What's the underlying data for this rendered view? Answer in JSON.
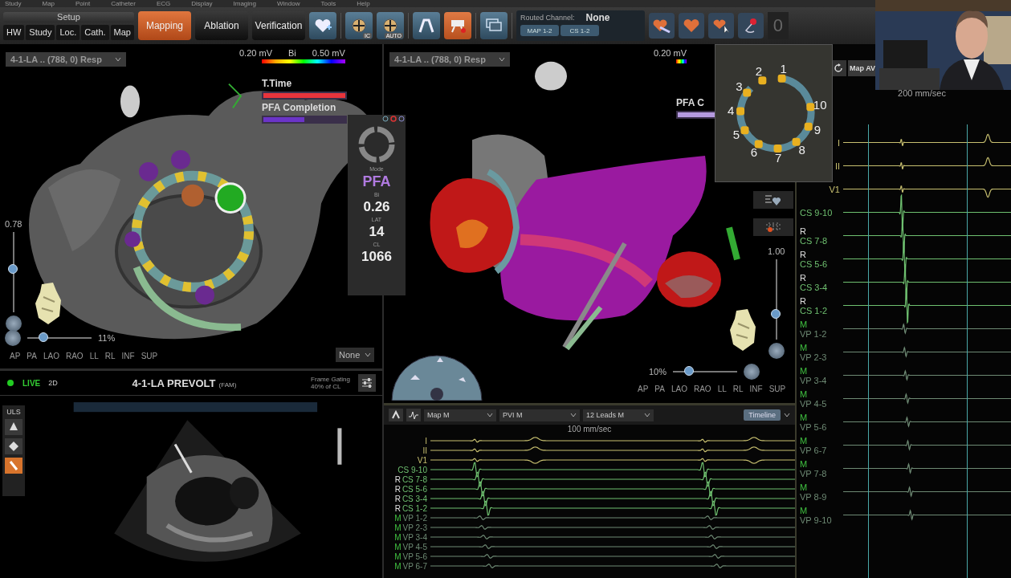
{
  "menu": [
    "Study",
    "Map",
    "Point",
    "Catheter",
    "ECG",
    "Display",
    "Imaging",
    "Window",
    "Tools",
    "Help"
  ],
  "toolbar": {
    "setup": {
      "label": "Setup",
      "tabs": [
        {
          "label": "HW",
          "selected": false
        },
        {
          "label": "Study",
          "selected": false
        },
        {
          "label": "Loc.",
          "selected": false
        },
        {
          "label": "Cath.",
          "selected": false
        },
        {
          "label": "Map",
          "selected": false
        }
      ]
    },
    "workflow": [
      {
        "label": "Mapping",
        "selected": true
      },
      {
        "label": "Ablation",
        "selected": false
      },
      {
        "label": "Verification",
        "selected": false
      }
    ],
    "tools": [
      {
        "kind": "heart-plus",
        "selected": false
      },
      {
        "kind": "target",
        "badge": "IC",
        "selected": false
      },
      {
        "kind": "target",
        "badge": "AUTO",
        "selected": false
      },
      {
        "kind": "arch",
        "selected": false
      },
      {
        "kind": "projector",
        "selected": true
      },
      {
        "kind": "windows",
        "selected": false
      }
    ],
    "routed_channel": {
      "label": "Routed Channel:",
      "value": "None",
      "channels": [
        "MAP 1-2",
        "CS 1-2"
      ]
    },
    "map_tools": [
      {
        "kind": "heart-arrow"
      },
      {
        "kind": "heart"
      },
      {
        "kind": "heart-pointer"
      },
      {
        "kind": "pin"
      }
    ],
    "counter": "0"
  },
  "left_map": {
    "view": "4-1-LA .. (788, 0) Resp",
    "scale": {
      "min": "0.20 mV",
      "name": "Bi",
      "max": "0.50 mV"
    },
    "legend": [
      {
        "label": "T.Time",
        "color": "#e8343c",
        "level": 1
      },
      {
        "label": "PFA Completion",
        "color": "#6b34c8",
        "level": 0.5
      }
    ],
    "opacity": {
      "reading": "0.78",
      "level": 0.55
    },
    "zoom": {
      "reading": "11%",
      "level": 0.2
    },
    "views": [
      "AP",
      "PA",
      "LAO",
      "RAO",
      "LL",
      "RL",
      "INF",
      "SUP"
    ],
    "overlay": "None"
  },
  "readout": {
    "mode_label": "Mode",
    "mode": "PFA",
    "fields": [
      {
        "label": "Bi",
        "value": "0.26"
      },
      {
        "label": "LAT",
        "value": "14"
      },
      {
        "label": "CL",
        "value": "1066"
      }
    ]
  },
  "right_map": {
    "view": "4-1-LA .. (788, 0) Resp",
    "scale_min": "0.20 mV",
    "legend": [
      {
        "label": "PFA C",
        "color": "#b59ae0",
        "level": 1
      }
    ],
    "opacity": {
      "reading": "1.00",
      "level": 0.3
    },
    "zoom": {
      "reading": "10%",
      "level": 0.2
    },
    "views": [
      "AP",
      "PA",
      "LAO",
      "RAO",
      "LL",
      "RL",
      "INF",
      "SUP"
    ]
  },
  "catheter_view": {
    "electrodes": [
      "1",
      "2",
      "3",
      "4",
      "5",
      "6",
      "7",
      "8",
      "9",
      "10"
    ]
  },
  "ultrasound": {
    "live": "LIVE",
    "mode": "2D",
    "title": "4-1-LA PREVOLT",
    "suffix": "(FAM)",
    "gating": {
      "label": "Frame Gating",
      "value": "40% of CL"
    },
    "tools_label": "ULS",
    "tools": [
      {
        "kind": "probe",
        "selected": false
      },
      {
        "kind": "plane",
        "selected": false
      },
      {
        "kind": "catheter",
        "selected": true
      }
    ]
  },
  "timeline_ecg": {
    "dropdowns": [
      "Map M",
      "PVI M",
      "12 Leads M"
    ],
    "timeline": "Timeline",
    "speed": "100 mm/sec",
    "channels": [
      {
        "name": "I",
        "kind": "surface"
      },
      {
        "name": "II",
        "kind": "surface"
      },
      {
        "name": "V1",
        "kind": "surface"
      },
      {
        "name": "CS 9-10",
        "kind": "cs"
      },
      {
        "name": "CS 7-8",
        "tag": "R",
        "kind": "cs"
      },
      {
        "name": "CS 5-6",
        "tag": "R",
        "kind": "cs"
      },
      {
        "name": "CS 3-4",
        "tag": "R",
        "kind": "cs"
      },
      {
        "name": "CS 1-2",
        "tag": "R",
        "kind": "cs"
      },
      {
        "name": "VP 1-2",
        "tag": "M",
        "kind": "vp"
      },
      {
        "name": "VP 2-3",
        "tag": "M",
        "kind": "vp"
      },
      {
        "name": "VP 3-4",
        "tag": "M",
        "kind": "vp"
      },
      {
        "name": "VP 4-5",
        "tag": "M",
        "kind": "vp"
      },
      {
        "name": "VP 5-6",
        "tag": "M",
        "kind": "vp"
      },
      {
        "name": "VP 6-7",
        "tag": "M",
        "kind": "vp"
      }
    ]
  },
  "ecg": {
    "button": "Map AV",
    "speed": "200 mm/sec",
    "channels": [
      {
        "name": "I",
        "kind": "surface"
      },
      {
        "name": "II",
        "kind": "surface"
      },
      {
        "name": "V1",
        "kind": "surface"
      },
      {
        "name": "CS 9-10",
        "kind": "cs"
      },
      {
        "name": "CS 7-8",
        "tag": "R",
        "kind": "cs"
      },
      {
        "name": "CS 5-6",
        "tag": "R",
        "kind": "cs"
      },
      {
        "name": "CS 3-4",
        "tag": "R",
        "kind": "cs"
      },
      {
        "name": "CS 1-2",
        "tag": "R",
        "kind": "cs"
      },
      {
        "name": "VP 1-2",
        "tag": "M",
        "kind": "vp"
      },
      {
        "name": "VP 2-3",
        "tag": "M",
        "kind": "vp"
      },
      {
        "name": "VP 3-4",
        "tag": "M",
        "kind": "vp"
      },
      {
        "name": "VP 4-5",
        "tag": "M",
        "kind": "vp"
      },
      {
        "name": "VP 5-6",
        "tag": "M",
        "kind": "vp"
      },
      {
        "name": "VP 6-7",
        "tag": "M",
        "kind": "vp"
      },
      {
        "name": "VP 7-8",
        "tag": "M",
        "kind": "vp"
      },
      {
        "name": "VP 8-9",
        "tag": "M",
        "kind": "vp"
      },
      {
        "name": "VP 9-10",
        "tag": "M",
        "kind": "vp"
      }
    ]
  }
}
